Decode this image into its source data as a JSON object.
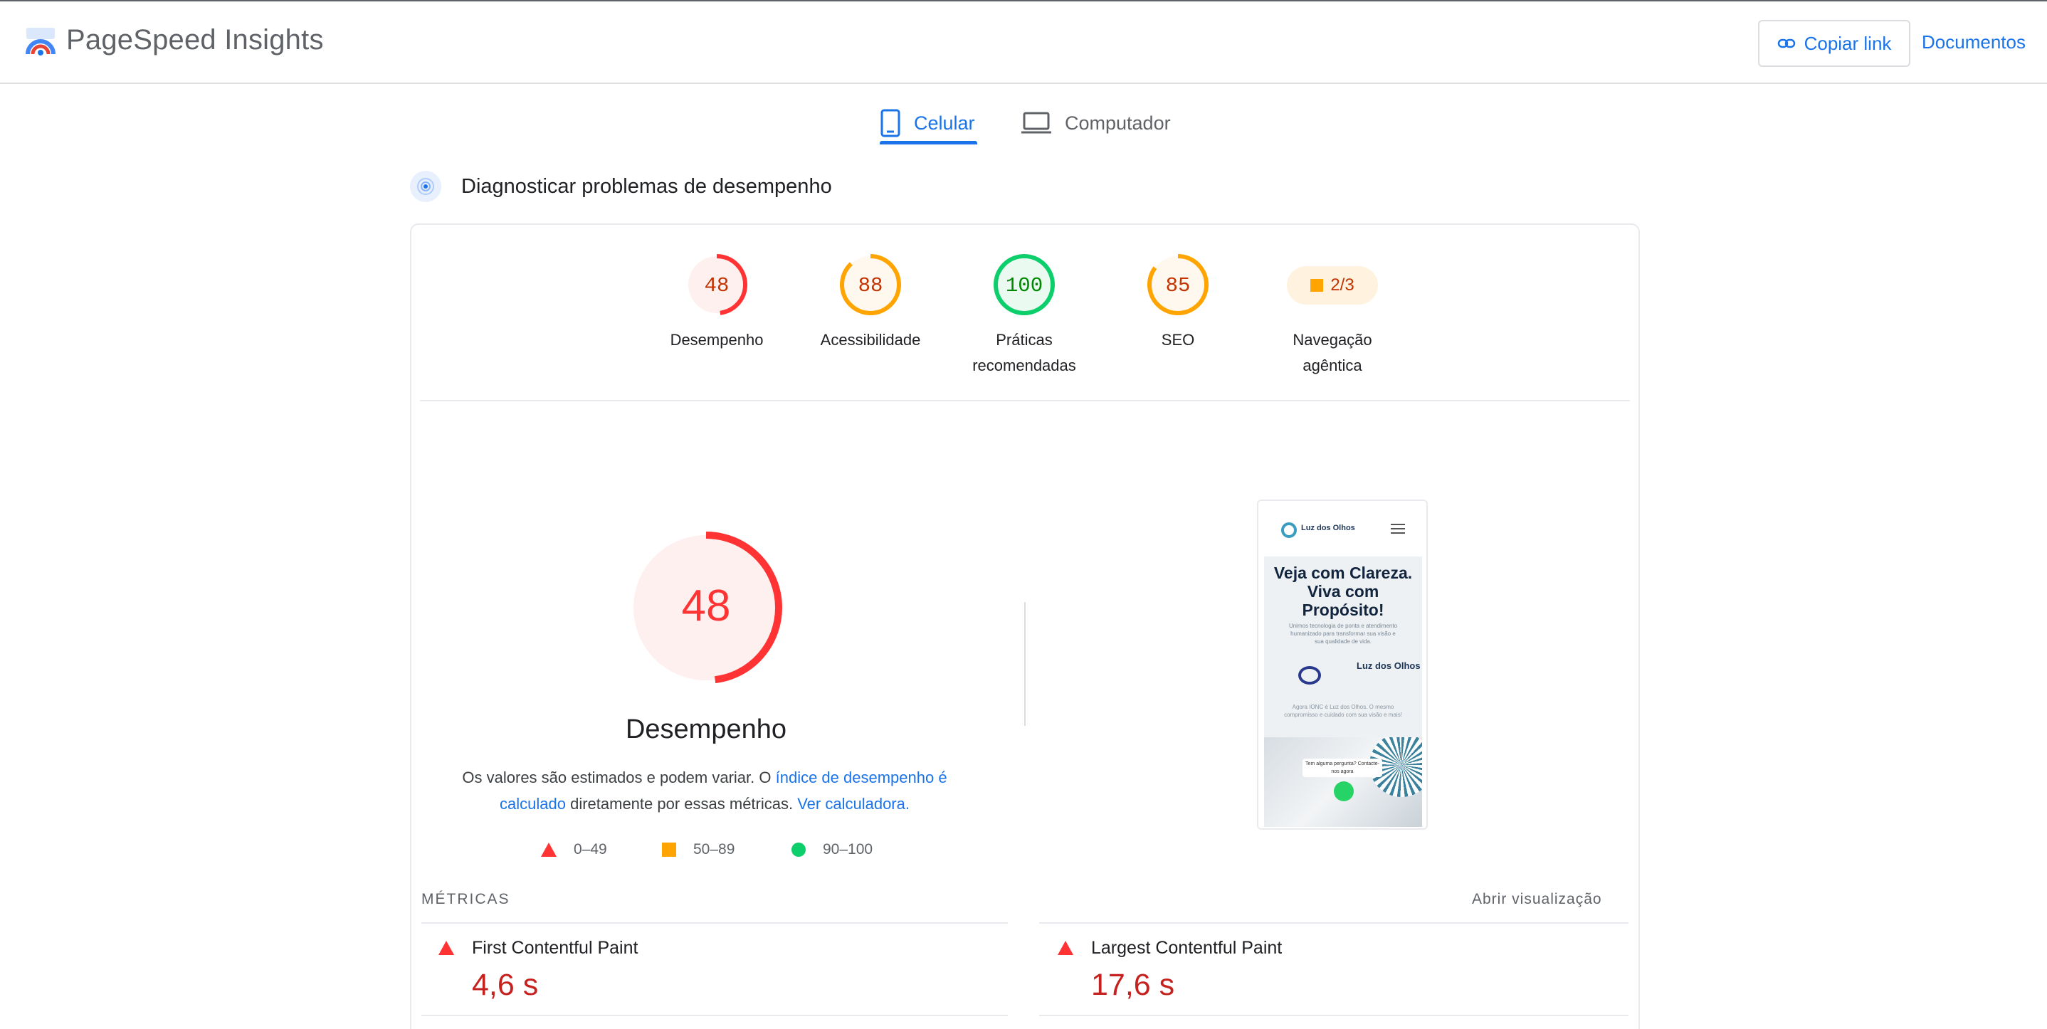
{
  "header": {
    "brand": "PageSpeed Insights",
    "copy_link": "Copiar link",
    "docs": "Documentos"
  },
  "tabs": [
    {
      "label": "Celular",
      "active": true
    },
    {
      "label": "Computador",
      "active": false
    }
  ],
  "diagnose": {
    "title": "Diagnosticar problemas de desempenho"
  },
  "categories": [
    {
      "score": "48",
      "label": "Desempenho",
      "level": 0.48,
      "color": "#ff3333",
      "fill": "#fff0f0",
      "text": "#c33300"
    },
    {
      "score": "88",
      "label": "Acessibilidade",
      "level": 0.88,
      "color": "#ffa400",
      "fill": "#fff8ee",
      "text": "#c33300"
    },
    {
      "score": "100",
      "label_1": "Práticas",
      "label_2": "recomendadas",
      "level": 1.0,
      "color": "#0cce6b",
      "fill": "#eafaf1",
      "text": "#008800"
    },
    {
      "score": "85",
      "label": "SEO",
      "level": 0.85,
      "color": "#ffa400",
      "fill": "#fff8ee",
      "text": "#c33300"
    },
    {
      "score": "2/3",
      "label_1": "Navegação",
      "label_2": "agêntica",
      "color": "#ffa400"
    }
  ],
  "performance": {
    "score": "48",
    "level": 0.48,
    "title": "Desempenho",
    "note_1": "Os valores são estimados e podem variar. O ",
    "note_link_1": "índice de desempenho é calculado",
    "note_2": " diretamente por essas métricas. ",
    "note_link_2": "Ver calculadora.",
    "legend": [
      {
        "range": "0–49",
        "color": "#ff3333"
      },
      {
        "range": "50–89",
        "color": "#ffa400"
      },
      {
        "range": "90–100",
        "color": "#0cce6b"
      }
    ]
  },
  "screenshot": {
    "brand": "Luz dos Olhos",
    "headline": "Veja com Clareza. Viva com Propósito!",
    "sub": "Unimos tecnologia de ponta e atendimento humanizado para transformar sua visão e sua qualidade de vida.",
    "logo2": "Luz dos Olhos",
    "sub2": "Agora IONC é Luz dos Olhos. O mesmo compromisso e cuidado com sua visão e mais!",
    "chat": "Tem alguma pergunta? Contacte-nos agora"
  },
  "metrics": {
    "title": "MÉTRICAS",
    "expand": "Abrir visualização",
    "items": [
      {
        "name": "First Contentful Paint",
        "value": "4,6 s"
      },
      {
        "name": "Largest Contentful Paint",
        "value": "17,6 s"
      }
    ]
  }
}
